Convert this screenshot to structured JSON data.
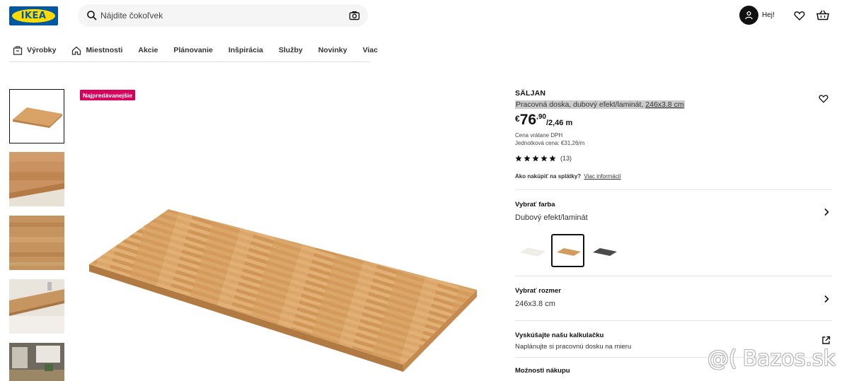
{
  "header": {
    "logo_text": "IKEA",
    "search_placeholder": "Nájdite čokoľvek",
    "greeting": "Hej!"
  },
  "nav": {
    "items": [
      "Výrobky",
      "Miestnosti",
      "Akcie",
      "Plánovanie",
      "Inšpirácia",
      "Služby",
      "Novinky",
      "Viac"
    ]
  },
  "gallery": {
    "badge": "Najpredávanejšie",
    "thumbnail_count": 5,
    "active_index": 0
  },
  "product": {
    "name": "SÄLJAN",
    "description": "Pracovná doska, dubový efekt/laminát,",
    "size_link": "246x3.8 cm",
    "currency": "€",
    "price_int": "76",
    "price_dec": ",90",
    "price_unit": "/2,46 m",
    "vat_note": "Cena vrátane DPH",
    "unit_price": "Jednotková cena: €31,26/m",
    "rating": 5,
    "review_count": "(13)",
    "installment_q": "Ako nakúpiť na splátky?",
    "installment_link": "Viac informácií"
  },
  "color": {
    "title": "Vybrať farba",
    "value": "Dubový efekt/laminát",
    "swatches": [
      "white",
      "oak",
      "dark-grey"
    ],
    "selected_index": 1
  },
  "size": {
    "title": "Vybrať rozmer",
    "value": "246x3.8 cm"
  },
  "calculator": {
    "title": "Vyskúšajte našu kalkulačku",
    "subtitle": "Naplánujte si pracovnú dosku na mieru"
  },
  "purchase": {
    "title": "Možnosti nákupu"
  },
  "watermark": {
    "text": "Bazos.sk"
  },
  "colors": {
    "brand_blue": "#0058a3",
    "brand_yellow": "#ffdb00",
    "badge": "#d6005c",
    "text": "#111111"
  }
}
